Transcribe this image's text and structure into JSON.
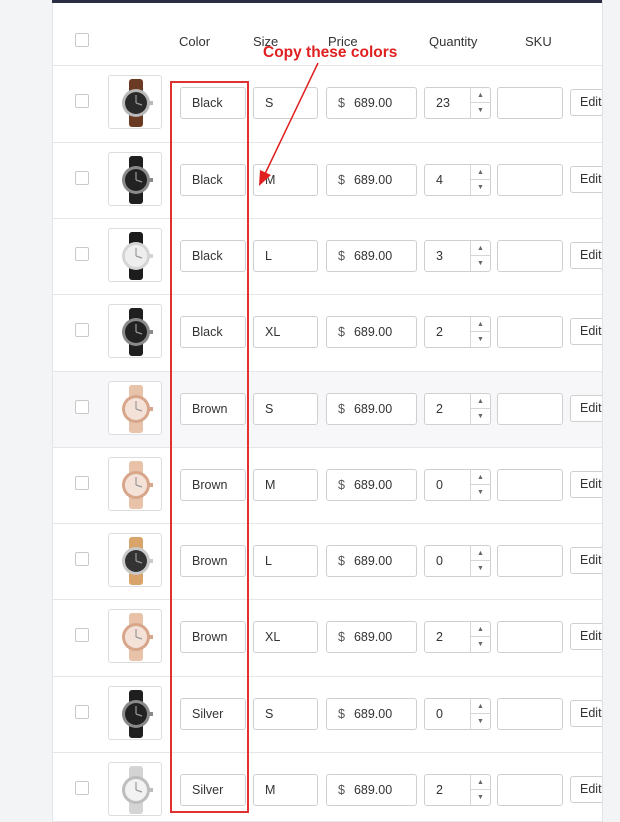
{
  "header": {
    "color_label": "Color",
    "size_label": "Size",
    "price_label": "Price",
    "quantity_label": "Quantity",
    "sku_label": "SKU"
  },
  "annotation": {
    "text": "Copy these colors",
    "color": "#e02020"
  },
  "currency_symbol": "$",
  "edit_label": "Edit",
  "rows": [
    {
      "color": "Black",
      "size": "S",
      "price": "689.00",
      "quantity": "23",
      "sku": "",
      "icon": "watch-brown-strap-icon"
    },
    {
      "color": "Black",
      "size": "M",
      "price": "689.00",
      "quantity": "4",
      "sku": "",
      "icon": "watch-black-icon"
    },
    {
      "color": "Black",
      "size": "L",
      "price": "689.00",
      "quantity": "3",
      "sku": "",
      "icon": "watch-silver-dial-icon"
    },
    {
      "color": "Black",
      "size": "XL",
      "price": "689.00",
      "quantity": "2",
      "sku": "",
      "icon": "watch-black-icon"
    },
    {
      "color": "Brown",
      "size": "S",
      "price": "689.00",
      "quantity": "2",
      "sku": "",
      "icon": "watch-rose-gold-icon"
    },
    {
      "color": "Brown",
      "size": "M",
      "price": "689.00",
      "quantity": "0",
      "sku": "",
      "icon": "watch-rose-gold-icon"
    },
    {
      "color": "Brown",
      "size": "L",
      "price": "689.00",
      "quantity": "0",
      "sku": "",
      "icon": "watch-tan-strap-icon"
    },
    {
      "color": "Brown",
      "size": "XL",
      "price": "689.00",
      "quantity": "2",
      "sku": "",
      "icon": "watch-rose-gold-icon"
    },
    {
      "color": "Silver",
      "size": "S",
      "price": "689.00",
      "quantity": "0",
      "sku": "",
      "icon": "watch-black-icon"
    },
    {
      "color": "Silver",
      "size": "M",
      "price": "689.00",
      "quantity": "2",
      "sku": "",
      "icon": "watch-silver-bracelet-icon"
    }
  ]
}
